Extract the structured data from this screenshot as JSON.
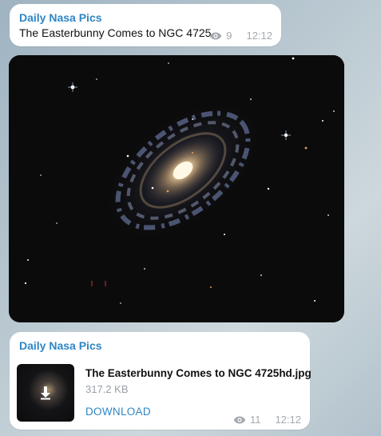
{
  "message1": {
    "sender": "Daily Nasa Pics",
    "text": "The Easterbunny Comes to NGC 4725",
    "views": "9",
    "time": "12:12"
  },
  "photo": {
    "icon": "galaxy-photo"
  },
  "message2": {
    "sender": "Daily Nasa Pics",
    "file_name": "The Easterbunny Comes to NGC 4725hd.jpg",
    "file_size": "317.2 KB",
    "download_label": "DOWNLOAD",
    "views": "11",
    "time": "12:12"
  },
  "colors": {
    "accent": "#2f86c4",
    "meta": "#a4a9ae",
    "bubble": "#ffffff"
  }
}
